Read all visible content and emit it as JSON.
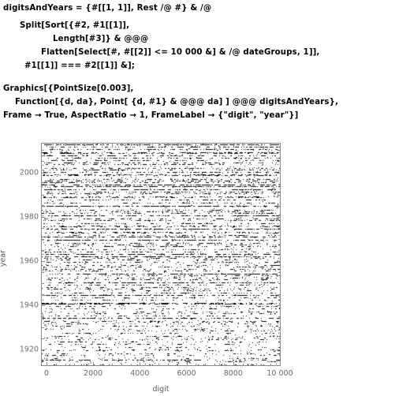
{
  "code": {
    "lines": [
      {
        "text": "digitsAndYears = {#[[1, 1]], Rest /@ #} & /@",
        "x": 4,
        "y": 5
      },
      {
        "text": "Split[Sort[{#2, #1[[1]],",
        "x": 25,
        "y": 27
      },
      {
        "text": "Length[#3]} & @@@",
        "x": 67,
        "y": 44
      },
      {
        "text": "Flatten[Select[#, #[[2]] <= 10 000 &] & /@ dateGroups, 1]],",
        "x": 52,
        "y": 61
      },
      {
        "text": "#1[[1]] === #2[[1]] &];",
        "x": 31,
        "y": 78
      },
      {
        "text": "Graphics[{PointSize[0.003],",
        "x": 4,
        "y": 107
      },
      {
        "text": "Function[{d, da}, Point[ {d, #1} & @@@ da] ] @@@ digitsAndYears},",
        "x": 19,
        "y": 124
      },
      {
        "text": "Frame → True, AspectRatio → 1, FrameLabel → {\"digit\", \"year\"}]",
        "x": 4,
        "y": 141
      }
    ]
  },
  "chart_data": {
    "type": "scatter",
    "title": "",
    "xlabel": "digit",
    "ylabel": "year",
    "xlim": [
      -200,
      10000
    ],
    "ylim": [
      1913,
      2013
    ],
    "grid": false,
    "legend": false,
    "frame": true,
    "aspect_ratio": 1,
    "point_size": 0.003,
    "point_color": "#000000",
    "frame_color": "#8a8a8a",
    "tick_label_color": "#6b6b6b",
    "x_ticks": [
      {
        "value": 0,
        "label": "0"
      },
      {
        "value": 2000,
        "label": "2000"
      },
      {
        "value": 4000,
        "label": "4000"
      },
      {
        "value": 6000,
        "label": "6000"
      },
      {
        "value": 8000,
        "label": "8000"
      },
      {
        "value": 10000,
        "label": "10 000"
      }
    ],
    "x_minor_ticks": [
      400,
      800,
      1200,
      1600,
      2400,
      2800,
      3200,
      3600,
      4400,
      4800,
      5200,
      5600,
      6400,
      6800,
      7200,
      7600,
      8400,
      8800,
      9200,
      9600
    ],
    "y_ticks": [
      {
        "value": 2000,
        "label": "2000"
      },
      {
        "value": 1980,
        "label": "1980"
      },
      {
        "value": 1960,
        "label": "1960"
      },
      {
        "value": 1940,
        "label": "1940"
      },
      {
        "value": 1920,
        "label": "1920"
      }
    ],
    "y_minor_ticks": [
      2010,
      2005,
      1995,
      1990,
      1985,
      1975,
      1970,
      1965,
      1955,
      1950,
      1945,
      1935,
      1930,
      1925,
      1915
    ],
    "description": "Dense black point scatter; x = digit position 0-10000, y = year ~1913-2013. Density increases toward more recent years; near-uniform horizontal coverage across all digit positions.",
    "approx_point_count": 9000
  }
}
